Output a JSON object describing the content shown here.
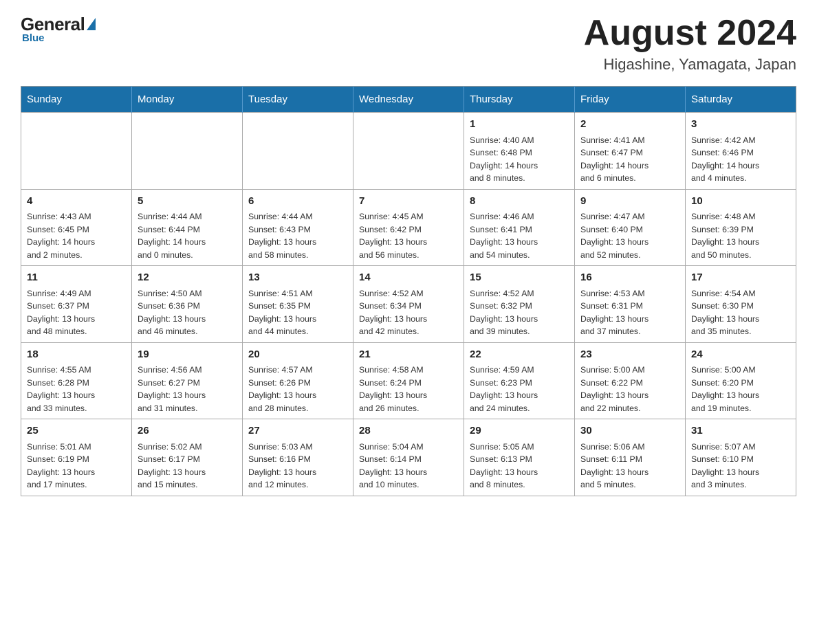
{
  "logo": {
    "general": "General",
    "blue": "Blue",
    "bottom": "Blue"
  },
  "title": "August 2024",
  "subtitle": "Higashine, Yamagata, Japan",
  "weekdays": [
    "Sunday",
    "Monday",
    "Tuesday",
    "Wednesday",
    "Thursday",
    "Friday",
    "Saturday"
  ],
  "weeks": [
    [
      {
        "day": "",
        "info": ""
      },
      {
        "day": "",
        "info": ""
      },
      {
        "day": "",
        "info": ""
      },
      {
        "day": "",
        "info": ""
      },
      {
        "day": "1",
        "info": "Sunrise: 4:40 AM\nSunset: 6:48 PM\nDaylight: 14 hours\nand 8 minutes."
      },
      {
        "day": "2",
        "info": "Sunrise: 4:41 AM\nSunset: 6:47 PM\nDaylight: 14 hours\nand 6 minutes."
      },
      {
        "day": "3",
        "info": "Sunrise: 4:42 AM\nSunset: 6:46 PM\nDaylight: 14 hours\nand 4 minutes."
      }
    ],
    [
      {
        "day": "4",
        "info": "Sunrise: 4:43 AM\nSunset: 6:45 PM\nDaylight: 14 hours\nand 2 minutes."
      },
      {
        "day": "5",
        "info": "Sunrise: 4:44 AM\nSunset: 6:44 PM\nDaylight: 14 hours\nand 0 minutes."
      },
      {
        "day": "6",
        "info": "Sunrise: 4:44 AM\nSunset: 6:43 PM\nDaylight: 13 hours\nand 58 minutes."
      },
      {
        "day": "7",
        "info": "Sunrise: 4:45 AM\nSunset: 6:42 PM\nDaylight: 13 hours\nand 56 minutes."
      },
      {
        "day": "8",
        "info": "Sunrise: 4:46 AM\nSunset: 6:41 PM\nDaylight: 13 hours\nand 54 minutes."
      },
      {
        "day": "9",
        "info": "Sunrise: 4:47 AM\nSunset: 6:40 PM\nDaylight: 13 hours\nand 52 minutes."
      },
      {
        "day": "10",
        "info": "Sunrise: 4:48 AM\nSunset: 6:39 PM\nDaylight: 13 hours\nand 50 minutes."
      }
    ],
    [
      {
        "day": "11",
        "info": "Sunrise: 4:49 AM\nSunset: 6:37 PM\nDaylight: 13 hours\nand 48 minutes."
      },
      {
        "day": "12",
        "info": "Sunrise: 4:50 AM\nSunset: 6:36 PM\nDaylight: 13 hours\nand 46 minutes."
      },
      {
        "day": "13",
        "info": "Sunrise: 4:51 AM\nSunset: 6:35 PM\nDaylight: 13 hours\nand 44 minutes."
      },
      {
        "day": "14",
        "info": "Sunrise: 4:52 AM\nSunset: 6:34 PM\nDaylight: 13 hours\nand 42 minutes."
      },
      {
        "day": "15",
        "info": "Sunrise: 4:52 AM\nSunset: 6:32 PM\nDaylight: 13 hours\nand 39 minutes."
      },
      {
        "day": "16",
        "info": "Sunrise: 4:53 AM\nSunset: 6:31 PM\nDaylight: 13 hours\nand 37 minutes."
      },
      {
        "day": "17",
        "info": "Sunrise: 4:54 AM\nSunset: 6:30 PM\nDaylight: 13 hours\nand 35 minutes."
      }
    ],
    [
      {
        "day": "18",
        "info": "Sunrise: 4:55 AM\nSunset: 6:28 PM\nDaylight: 13 hours\nand 33 minutes."
      },
      {
        "day": "19",
        "info": "Sunrise: 4:56 AM\nSunset: 6:27 PM\nDaylight: 13 hours\nand 31 minutes."
      },
      {
        "day": "20",
        "info": "Sunrise: 4:57 AM\nSunset: 6:26 PM\nDaylight: 13 hours\nand 28 minutes."
      },
      {
        "day": "21",
        "info": "Sunrise: 4:58 AM\nSunset: 6:24 PM\nDaylight: 13 hours\nand 26 minutes."
      },
      {
        "day": "22",
        "info": "Sunrise: 4:59 AM\nSunset: 6:23 PM\nDaylight: 13 hours\nand 24 minutes."
      },
      {
        "day": "23",
        "info": "Sunrise: 5:00 AM\nSunset: 6:22 PM\nDaylight: 13 hours\nand 22 minutes."
      },
      {
        "day": "24",
        "info": "Sunrise: 5:00 AM\nSunset: 6:20 PM\nDaylight: 13 hours\nand 19 minutes."
      }
    ],
    [
      {
        "day": "25",
        "info": "Sunrise: 5:01 AM\nSunset: 6:19 PM\nDaylight: 13 hours\nand 17 minutes."
      },
      {
        "day": "26",
        "info": "Sunrise: 5:02 AM\nSunset: 6:17 PM\nDaylight: 13 hours\nand 15 minutes."
      },
      {
        "day": "27",
        "info": "Sunrise: 5:03 AM\nSunset: 6:16 PM\nDaylight: 13 hours\nand 12 minutes."
      },
      {
        "day": "28",
        "info": "Sunrise: 5:04 AM\nSunset: 6:14 PM\nDaylight: 13 hours\nand 10 minutes."
      },
      {
        "day": "29",
        "info": "Sunrise: 5:05 AM\nSunset: 6:13 PM\nDaylight: 13 hours\nand 8 minutes."
      },
      {
        "day": "30",
        "info": "Sunrise: 5:06 AM\nSunset: 6:11 PM\nDaylight: 13 hours\nand 5 minutes."
      },
      {
        "day": "31",
        "info": "Sunrise: 5:07 AM\nSunset: 6:10 PM\nDaylight: 13 hours\nand 3 minutes."
      }
    ]
  ]
}
